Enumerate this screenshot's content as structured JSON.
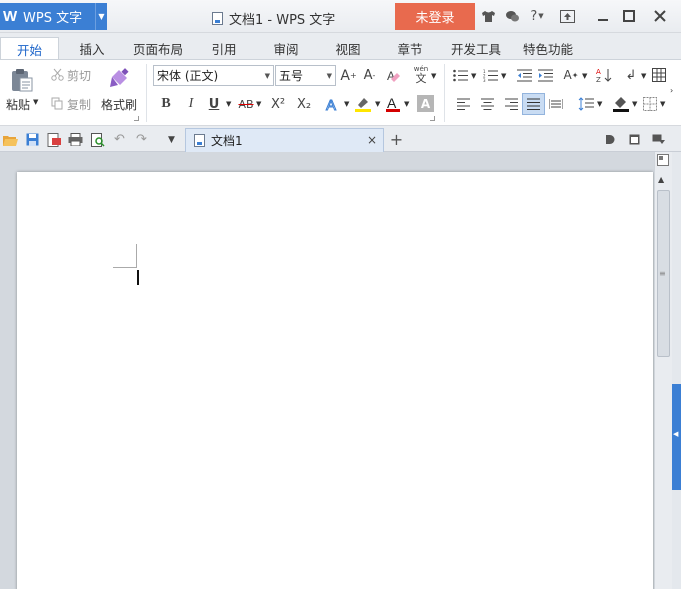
{
  "app": {
    "logo": "W",
    "name": "WPS 文字",
    "document_title": "文档1 - WPS 文字",
    "login_label": "未登录"
  },
  "menu": {
    "tabs": [
      "开始",
      "插入",
      "页面布局",
      "引用",
      "审阅",
      "视图",
      "章节",
      "开发工具",
      "特色功能"
    ],
    "active": "开始"
  },
  "ribbon": {
    "paste_label": "粘贴",
    "cut_label": "剪切",
    "copy_label": "复制",
    "format_painter_label": "格式刷",
    "font_name": "宋体 (正文)",
    "font_size": "五号",
    "bold": "B",
    "italic": "I",
    "underline": "U",
    "strikethrough": "AB",
    "superscript": "X²",
    "subscript": "X₂",
    "pinyin": "wén",
    "pinyin_char": "文"
  },
  "document_tabs": [
    {
      "label": "文档1",
      "close": "×"
    }
  ],
  "new_tab_label": "+",
  "colors": {
    "accent": "#3b7fd4",
    "login": "#e86a4e",
    "highlight": "#ffe600",
    "font_color": "#d40000"
  }
}
